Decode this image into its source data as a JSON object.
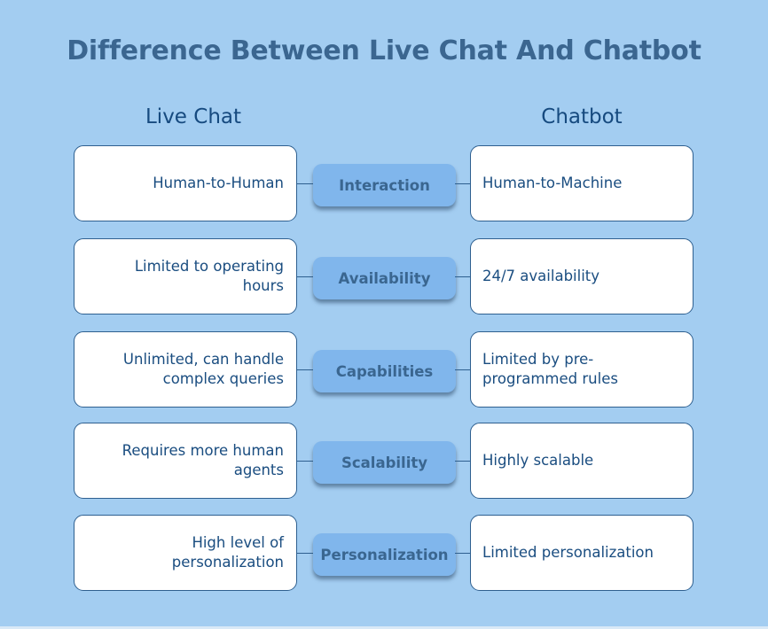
{
  "title": "Difference Between Live Chat And Chatbot",
  "columns": {
    "left": "Live Chat",
    "right": "Chatbot"
  },
  "rows": [
    {
      "category": "Interaction",
      "live_chat": "Human-to-Human",
      "chatbot": "Human-to-Machine"
    },
    {
      "category": "Availability",
      "live_chat": "Limited to operating hours",
      "chatbot": "24/7 availability"
    },
    {
      "category": "Capabilities",
      "live_chat": "Unlimited, can handle complex queries",
      "chatbot": "Limited by pre-programmed rules"
    },
    {
      "category": "Scalability",
      "live_chat": "Requires more human agents",
      "chatbot": "Highly scalable"
    },
    {
      "category": "Personalization",
      "live_chat": "High level of personalization",
      "chatbot": "Limited personalization"
    }
  ],
  "colors": {
    "background": "#a3cdf1",
    "title": "#3b6690",
    "text": "#1a4d80",
    "pill": "#80b6ec",
    "border": "#2e5f8f"
  }
}
